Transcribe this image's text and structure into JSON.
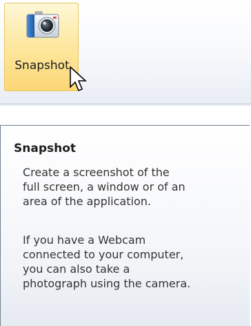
{
  "ribbon": {
    "snapshot_button": {
      "label": "Snapshot",
      "icon": "camera-icon"
    }
  },
  "tooltip": {
    "title": "Snapshot",
    "paragraph1": "Create a screenshot of the\nfull screen, a window or of an\narea of the application.",
    "paragraph2": "If you have a Webcam\nconnected to your computer,\nyou can also take a\nphotograph using the camera."
  },
  "colors": {
    "button_highlight": "#fcd775",
    "tooltip_border": "#6f7f8f",
    "camera_blue": "#2a6ab8"
  }
}
